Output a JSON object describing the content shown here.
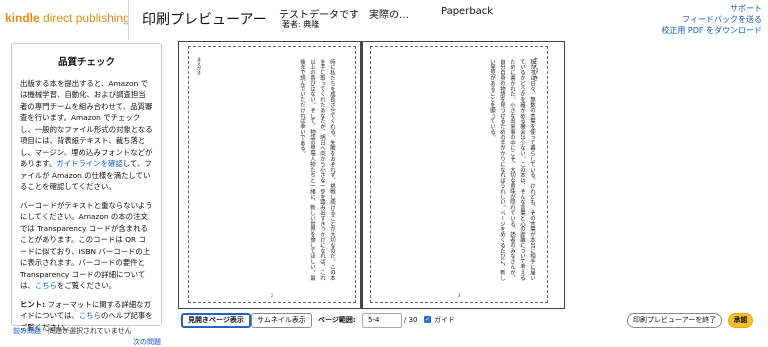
{
  "header": {
    "logo_kindle": "kindle",
    "logo_rest": "direct publishing",
    "app_title": "印刷プレビューアー",
    "book_title": "テストデータです　実際の…",
    "book_author": "著者: 典隆",
    "format": "Paperback",
    "links": [
      "サポート",
      "フィードバックを送る",
      "校正用 PDF をダウンロード"
    ]
  },
  "quality_panel": {
    "title": "品質チェック",
    "para1_a": "出版する本を提出すると、Amazon では機械学習、自動化、および調査担当者の専門チームを組み合わせて、品質審査を行います。Amazon でチェックし、一般的なファイル形式の対象となる項目には、背表紙テキスト、裁ち落とし、マージン、埋め込みフォントなどがあります。",
    "para1_link": "ガイドラインを確認",
    "para1_b": "して、ファイルが Amazon の仕様を満たしていることを確認してください。",
    "para2_a": "バーコードがテキストと重ならないようにしてください。Amazon の本の注文では Transparency コードが含まれることがあります。このコードは QR コードに似ており、ISBN バーコードの上に表示されます。バーコードの要件と Transparency コードの詳細については、",
    "para2_link": "こちら",
    "para2_b": "をご覧ください。",
    "hint_label": "ヒント:",
    "hint_a": " フォーマットに関する詳細なガイドについては、",
    "hint_link": "こちら",
    "hint_b": "のヘルプ記事をご覧ください。"
  },
  "issues": {
    "prev": "前の問題",
    "status": "問題が選択されていません",
    "next": "次の問題"
  },
  "preview": {
    "left_heading": "まえがき",
    "left_text": "時に私たちを成長させてくれる。失敗をおそれず、挑戦し続けることが大切なのだ。この本を手に取ってくれたあなたが、明日へ向かう小さな一歩を踏み出すきっかけになれば、これ以上の喜びはない。そして、物語の登場人物たちと一緒に、新しい世界を旅してほしい。最後まで読んでいただければ幸いである。",
    "left_page": "2",
    "right_heading": "まえがき",
    "right_text": "私たちは日々、無数の言葉を使って暮らしている。けれども、その言葉が本当に相手に届いているかどうかを確かめる機会は少ない。この本は、そんな言葉と心の距離について考えるために書かれた。小さな出来事の中にこそ、大切な意味が隠れている。読者のみなさんが、自分自身の物語を見つけるための手がかりになればうれしい。ページをめくるたびに、新しい発見があることを願っている。",
    "right_page": "3"
  },
  "controls": {
    "spread_btn": "見開きページ表示",
    "thumb_btn": "サムネイル表示",
    "range_label": "ページ範囲:",
    "range_value": "5-4",
    "range_total": "/ 30",
    "guide_check": "✓",
    "guide_label": "ガイド",
    "exit_btn": "印刷プレビューアーを終了",
    "approve_btn": "承認"
  },
  "colors": {
    "logo": "#e38b17",
    "link": "#1a56c4",
    "approve": "#f6c02e",
    "primary_border": "#2564c0"
  }
}
